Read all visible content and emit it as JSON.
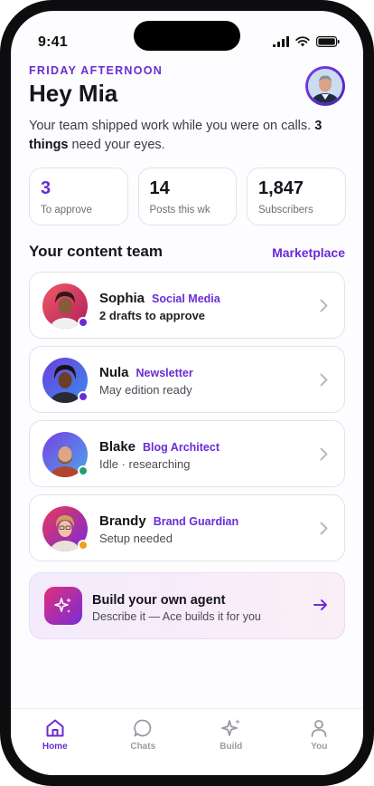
{
  "status_bar": {
    "time": "9:41"
  },
  "greeting": {
    "kicker": "FRIDAY AFTERNOON",
    "title": "Hey Mia",
    "intro_prefix": "Your team shipped work while you were on calls. ",
    "intro_bold": "3 things",
    "intro_suffix": " need your eyes."
  },
  "stats": [
    {
      "value": "3",
      "label": "To approve"
    },
    {
      "value": "14",
      "label": "Posts this wk"
    },
    {
      "value": "1,847",
      "label": "Subscribers"
    }
  ],
  "team_section": {
    "title": "Your content team",
    "link": "Marketplace"
  },
  "agents": [
    {
      "name": "Sophia",
      "role": "Social Media",
      "status": "2 drafts to approve",
      "presence": "#6b2bd6"
    },
    {
      "name": "Nula",
      "role": "Newsletter",
      "status": "May edition ready",
      "presence": "#6b2bd6"
    },
    {
      "name": "Blake",
      "role": "Blog Architect",
      "status": "Idle · researching",
      "presence": "#22a06b"
    },
    {
      "name": "Brandy",
      "role": "Brand Guardian",
      "status": "Setup needed",
      "presence": "#f0a020"
    }
  ],
  "build_card": {
    "title": "Build your own agent",
    "subtitle": "Describe it — Ace builds it for you",
    "icon": "sparkles-icon"
  },
  "tabbar": [
    {
      "label": "Home",
      "icon": "home-icon",
      "active": true
    },
    {
      "label": "Chats",
      "icon": "chat-bubble-icon",
      "active": false
    },
    {
      "label": "Build",
      "icon": "sparkles-icon",
      "active": false
    },
    {
      "label": "You",
      "icon": "person-icon",
      "active": false
    }
  ],
  "colors": {
    "accent": "#6b2bd6",
    "text": "#15151c",
    "muted": "#6d6d78"
  }
}
